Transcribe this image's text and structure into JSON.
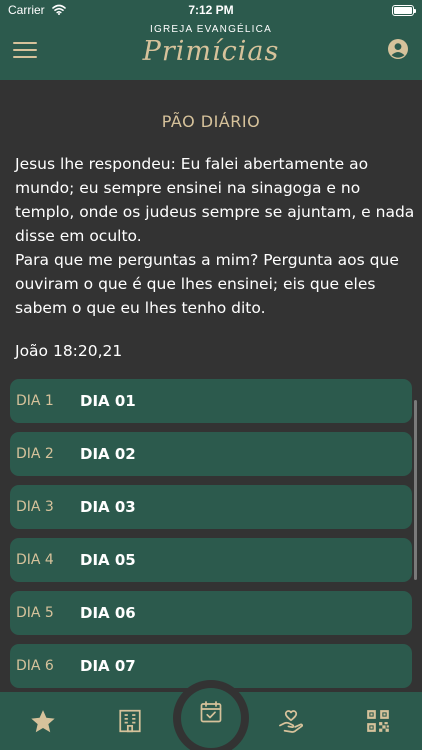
{
  "status_bar": {
    "carrier": "Carrier",
    "time": "7:12 PM",
    "icons": [
      "wifi-icon",
      "battery-icon"
    ]
  },
  "header": {
    "church_prefix": "IGREJA EVANGÉLICA",
    "church_name": "Primícias",
    "icons": [
      "hamburger-menu-icon",
      "user-profile-icon"
    ]
  },
  "devotional": {
    "title": "PÃO DIÁRIO",
    "verse_paragraphs": [
      "Jesus lhe respondeu: Eu falei abertamente ao mundo; eu sempre ensinei na sinagoga e no templo, onde os judeus sempre se ajuntam, e nada disse em oculto.",
      "Para que me perguntas a mim? Pergunta aos que ouviram o que é que lhes ensinei; eis que eles sabem o que eu lhes tenho dito."
    ],
    "reference": "João 18:20,21"
  },
  "days": [
    {
      "label": "DIA 1",
      "title": "DIA 01"
    },
    {
      "label": "DIA 2",
      "title": "DIA 02"
    },
    {
      "label": "DIA 3",
      "title": "DIA 03"
    },
    {
      "label": "DIA 4",
      "title": "DIA 05"
    },
    {
      "label": "DIA 5",
      "title": "DIA 06"
    },
    {
      "label": "DIA 6",
      "title": "DIA 07"
    }
  ],
  "tab_bar": {
    "tabs": [
      "star-icon",
      "building-icon",
      "calendar-check-icon",
      "hand-heart-icon",
      "qr-code-icon"
    ],
    "active": "calendar-check-icon"
  },
  "colors": {
    "background": "#333333",
    "primary_green": "#2c5a4d",
    "accent_gold": "#d6c29b",
    "text": "#ffffff"
  }
}
